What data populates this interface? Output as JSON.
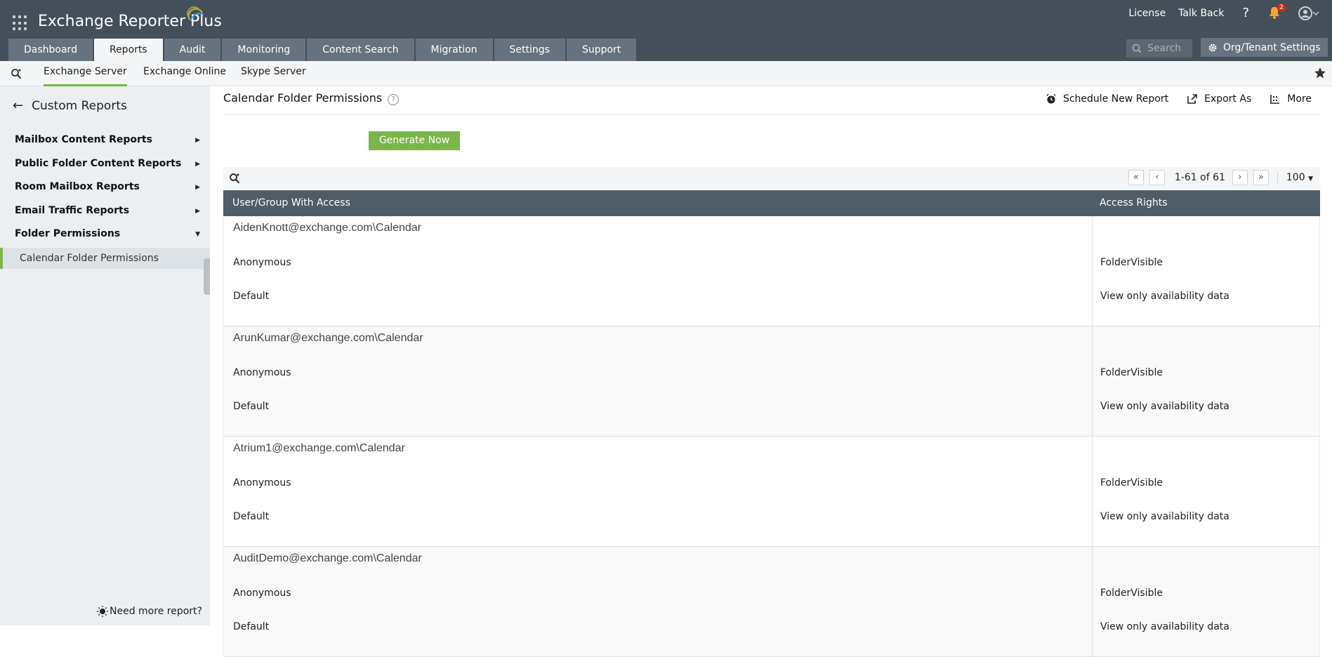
{
  "app": {
    "title": "Exchange Reporter Plus"
  },
  "topbar": {
    "license": "License",
    "talkback": "Talk Back",
    "help": "?",
    "notif_count": "2"
  },
  "nav": {
    "tabs": [
      {
        "label": "Dashboard"
      },
      {
        "label": "Reports"
      },
      {
        "label": "Audit"
      },
      {
        "label": "Monitoring"
      },
      {
        "label": "Content Search"
      },
      {
        "label": "Migration"
      },
      {
        "label": "Settings"
      },
      {
        "label": "Support"
      }
    ],
    "active": "Reports",
    "search_placeholder": "Search",
    "org_settings": "Org/Tenant Settings"
  },
  "subnav": {
    "tabs": [
      {
        "label": "Exchange Server"
      },
      {
        "label": "Exchange Online"
      },
      {
        "label": "Skype Server"
      }
    ]
  },
  "sidebar": {
    "title": "Custom Reports",
    "items": [
      {
        "label": "Mailbox Content Reports"
      },
      {
        "label": "Public Folder Content Reports"
      },
      {
        "label": "Room Mailbox Reports"
      },
      {
        "label": "Email Traffic Reports"
      },
      {
        "label": "Folder Permissions"
      }
    ],
    "active_sub": "Calendar Folder Permissions",
    "need_more": "Need more report?"
  },
  "main": {
    "title": "Calendar Folder Permissions",
    "help": "?",
    "actions": {
      "schedule": "Schedule New Report",
      "export": "Export As",
      "more": "More"
    },
    "generate": "Generate Now",
    "pager": {
      "range": "1-61 of 61",
      "page_size": "100"
    },
    "columns": {
      "user": "User/Group With Access",
      "rights": "Access Rights"
    },
    "groups": [
      {
        "folder": "AidenKnott@exchange.com\\Calendar",
        "rows": [
          {
            "user": "Anonymous",
            "rights": "FolderVisible"
          },
          {
            "user": "Default",
            "rights": "View only availability data"
          }
        ]
      },
      {
        "folder": "ArunKumar@exchange.com\\Calendar",
        "rows": [
          {
            "user": "Anonymous",
            "rights": "FolderVisible"
          },
          {
            "user": "Default",
            "rights": "View only availability data"
          }
        ]
      },
      {
        "folder": "Atrium1@exchange.com\\Calendar",
        "rows": [
          {
            "user": "Anonymous",
            "rights": "FolderVisible"
          },
          {
            "user": "Default",
            "rights": "View only availability data"
          }
        ]
      },
      {
        "folder": "AuditDemo@exchange.com\\Calendar",
        "rows": [
          {
            "user": "Anonymous",
            "rights": "FolderVisible"
          },
          {
            "user": "Default",
            "rights": "View only availability data"
          }
        ]
      }
    ]
  },
  "colors": {
    "topbar": "#454f59",
    "accent": "#7ab648",
    "header": "#505c66"
  }
}
